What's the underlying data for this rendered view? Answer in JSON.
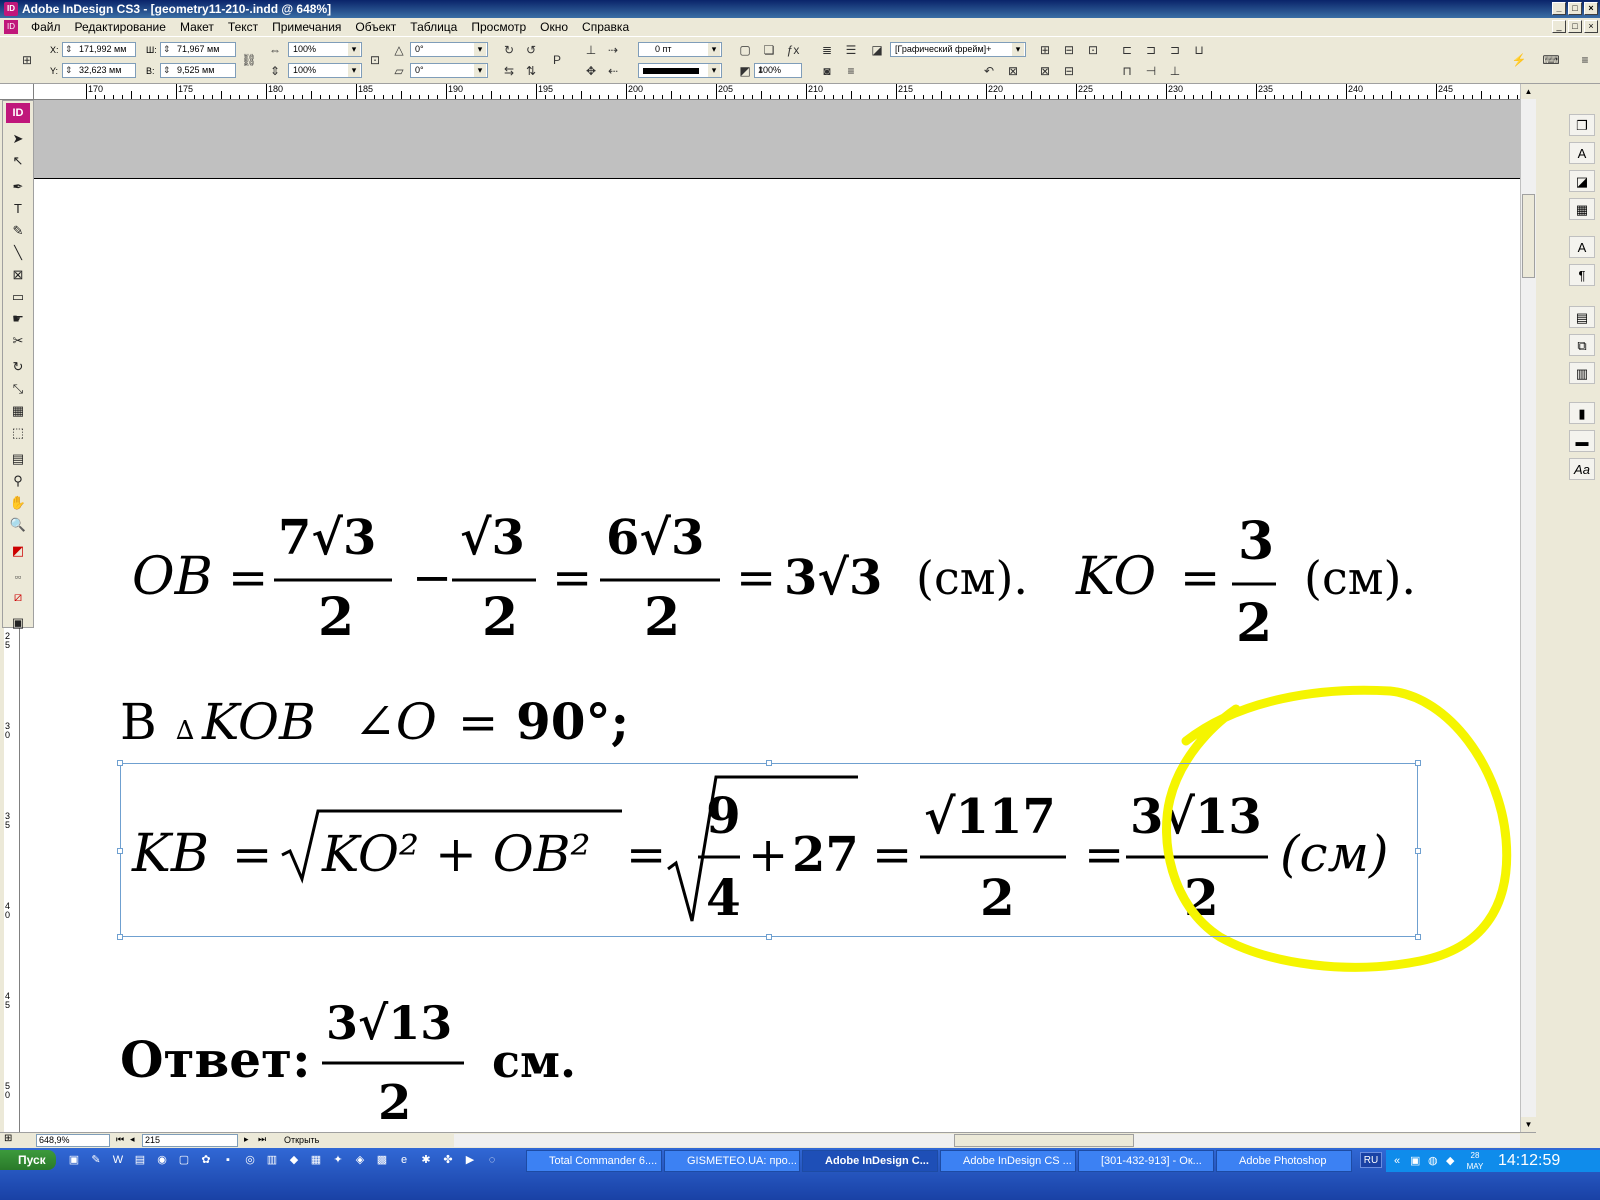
{
  "window": {
    "title": "Adobe InDesign CS3 - [geometry11-210-.indd @ 648%]",
    "app_badge": "ID"
  },
  "menu": [
    "Файл",
    "Редактирование",
    "Макет",
    "Текст",
    "Примечания",
    "Объект",
    "Таблица",
    "Просмотр",
    "Окно",
    "Справка"
  ],
  "control": {
    "x_label": "X:",
    "x_value": "171,992 мм",
    "y_label": "Y:",
    "y_value": "32,623 мм",
    "w_label": "Ш:",
    "w_value": "71,967 мм",
    "h_label": "В:",
    "h_value": "9,525 мм",
    "scale_x": "100%",
    "scale_y": "100%",
    "rotate": "0°",
    "shear": "0°",
    "stroke_weight": "0 пт",
    "opacity": "100%",
    "frame_style": "[Графический фрейм]+"
  },
  "ruler": {
    "labels": [
      "170",
      "175",
      "180",
      "185",
      "190",
      "195",
      "200",
      "205",
      "210",
      "215",
      "220",
      "225",
      "230",
      "235",
      "240",
      "245"
    ]
  },
  "vruler": {
    "labels": [
      "25",
      "30",
      "35",
      "40",
      "45",
      "50"
    ]
  },
  "document": {
    "line1": {
      "ob": "OB",
      "eq": "=",
      "n1": "7√3",
      "d1": "2",
      "minus": "−",
      "n2": "√3",
      "d2": "2",
      "n3": "6√3",
      "d3": "2",
      "r": "3√3",
      "unit": "(см).",
      "ko": "KO",
      "n4": "3",
      "d4": "2",
      "unit2": "(см)."
    },
    "line2": {
      "prefix": "В",
      "tri": "∆",
      "name": "KOB",
      "angle": "∠O",
      "eq": "=",
      "val": "90°;"
    },
    "line3": {
      "kb": "KB",
      "rad1": "KO² + OB²",
      "n1": "9",
      "d1": "4",
      "plus": "+",
      "c": "27",
      "n2": "√117",
      "d2": "2",
      "n3": "3√13",
      "d3": "2",
      "unit": "(см)"
    },
    "answer": {
      "label": "Ответ:",
      "num": "3√13",
      "den": "2",
      "unit": "см."
    }
  },
  "status": {
    "zoom": "648,9%",
    "page": "215",
    "open": "Открыть"
  },
  "taskbar": {
    "start": "Пуск",
    "tasks": [
      "Total Commander 6....",
      "GISMETEO.UA: про...",
      "Adobe InDesign C...",
      "Adobe InDesign CS ...",
      "[301-432-913] - Ок...",
      "Adobe Photoshop"
    ],
    "lang": "RU",
    "date": "28 MAY",
    "time": "14:12:59"
  },
  "colors": {
    "highlight": "#f5f500",
    "selection": "#6fa0d0",
    "accent": "#c0177b"
  }
}
